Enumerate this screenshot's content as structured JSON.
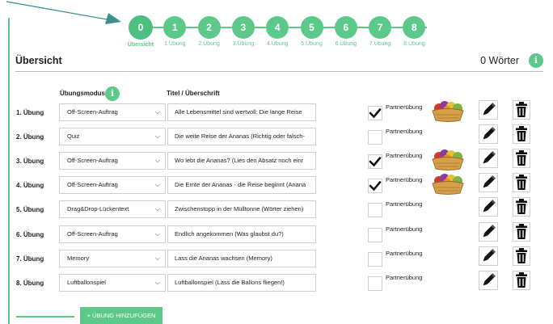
{
  "steps": [
    {
      "num": "0",
      "label": "Übersicht"
    },
    {
      "num": "1",
      "label": "1.Übung"
    },
    {
      "num": "2",
      "label": "2.Übung"
    },
    {
      "num": "3",
      "label": "3.Übung"
    },
    {
      "num": "4",
      "label": "4.Übung"
    },
    {
      "num": "5",
      "label": "5.Übung"
    },
    {
      "num": "6",
      "label": "6.Übung"
    },
    {
      "num": "7",
      "label": "7.Übung"
    },
    {
      "num": "8",
      "label": "8.Übung"
    }
  ],
  "overview": {
    "title": "Übersicht",
    "word_count": "0 Wörter",
    "col_mode": "Übungsmodus",
    "col_title": "Titel / Überschrift",
    "info_glyph": "i"
  },
  "rows": [
    {
      "label": "1. Übung",
      "mode": "Off-Screen-Auftrag",
      "title": "Alle Lebensmittel sind wertvoll: Die lange Reise",
      "partner_checked": true,
      "partner_label": "Partnerübung",
      "has_fruit_icon": true
    },
    {
      "label": "2. Übung",
      "mode": "Quiz",
      "title": "Die weite Reise der Ananas (Richtig oder falsch-",
      "partner_checked": false,
      "partner_label": "Partnerübung",
      "has_fruit_icon": false
    },
    {
      "label": "3. Übung",
      "mode": "Off-Screen-Auftrag",
      "title": "Wo lebt die Ananas? (Lies den Absatz noch einr",
      "partner_checked": true,
      "partner_label": "Partnerübung",
      "has_fruit_icon": true
    },
    {
      "label": "4. Übung",
      "mode": "Off-Screen-Auftrag",
      "title": "Die Ernte der Ananas - die Reise beginnt (Anana",
      "partner_checked": true,
      "partner_label": "Partnerübung",
      "has_fruit_icon": true
    },
    {
      "label": "5. Übung",
      "mode": "Drag&Drop-Lückentext",
      "title": "Zwischenstopp in der Mülltonne (Wörter ziehen)",
      "partner_checked": false,
      "partner_label": "Partnerübung",
      "has_fruit_icon": false
    },
    {
      "label": "6. Übung",
      "mode": "Off-Screen-Auftrag",
      "title": "Endlich angekommen (Was glaubst du?)",
      "partner_checked": false,
      "partner_label": "Partnerübung",
      "has_fruit_icon": false
    },
    {
      "label": "7. Übung",
      "mode": "Memory",
      "title": "Lass die Ananas wachsen (Memory)",
      "partner_checked": false,
      "partner_label": "Partnerübung",
      "has_fruit_icon": false
    },
    {
      "label": "8. Übung",
      "mode": "Luftballonspiel",
      "title": "Luftballonspiel (Lass die Ballons fliegen!)",
      "partner_checked": false,
      "partner_label": "Partnerübung",
      "has_fruit_icon": false
    }
  ],
  "add_button": {
    "label": "+ ÜBUNG HINZUFÜGEN"
  },
  "icons": {
    "edit": "pencil-icon",
    "delete": "trash-icon",
    "fruit": "fruit-basket-icon",
    "dropdown": "chevron-down-icon",
    "info": "info-icon"
  },
  "colors": {
    "accent": "#5cc98a"
  }
}
